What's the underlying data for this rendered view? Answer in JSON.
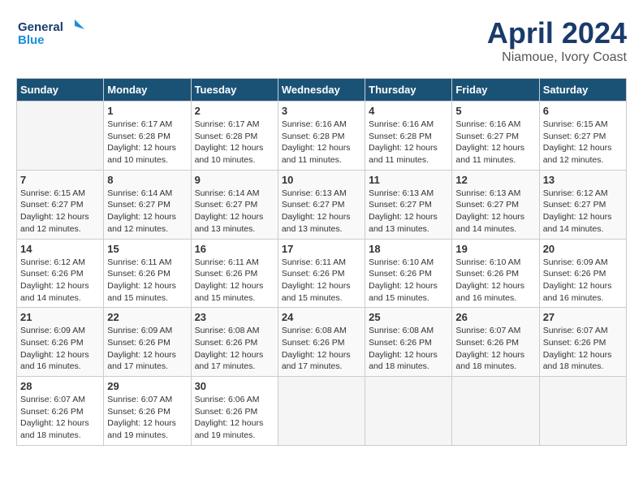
{
  "header": {
    "logo_line1": "General",
    "logo_line2": "Blue",
    "month": "April 2024",
    "location": "Niamoue, Ivory Coast"
  },
  "weekdays": [
    "Sunday",
    "Monday",
    "Tuesday",
    "Wednesday",
    "Thursday",
    "Friday",
    "Saturday"
  ],
  "weeks": [
    [
      {
        "day": "",
        "info": ""
      },
      {
        "day": "1",
        "info": "Sunrise: 6:17 AM\nSunset: 6:28 PM\nDaylight: 12 hours\nand 10 minutes."
      },
      {
        "day": "2",
        "info": "Sunrise: 6:17 AM\nSunset: 6:28 PM\nDaylight: 12 hours\nand 10 minutes."
      },
      {
        "day": "3",
        "info": "Sunrise: 6:16 AM\nSunset: 6:28 PM\nDaylight: 12 hours\nand 11 minutes."
      },
      {
        "day": "4",
        "info": "Sunrise: 6:16 AM\nSunset: 6:28 PM\nDaylight: 12 hours\nand 11 minutes."
      },
      {
        "day": "5",
        "info": "Sunrise: 6:16 AM\nSunset: 6:27 PM\nDaylight: 12 hours\nand 11 minutes."
      },
      {
        "day": "6",
        "info": "Sunrise: 6:15 AM\nSunset: 6:27 PM\nDaylight: 12 hours\nand 12 minutes."
      }
    ],
    [
      {
        "day": "7",
        "info": "Sunrise: 6:15 AM\nSunset: 6:27 PM\nDaylight: 12 hours\nand 12 minutes."
      },
      {
        "day": "8",
        "info": "Sunrise: 6:14 AM\nSunset: 6:27 PM\nDaylight: 12 hours\nand 12 minutes."
      },
      {
        "day": "9",
        "info": "Sunrise: 6:14 AM\nSunset: 6:27 PM\nDaylight: 12 hours\nand 13 minutes."
      },
      {
        "day": "10",
        "info": "Sunrise: 6:13 AM\nSunset: 6:27 PM\nDaylight: 12 hours\nand 13 minutes."
      },
      {
        "day": "11",
        "info": "Sunrise: 6:13 AM\nSunset: 6:27 PM\nDaylight: 12 hours\nand 13 minutes."
      },
      {
        "day": "12",
        "info": "Sunrise: 6:13 AM\nSunset: 6:27 PM\nDaylight: 12 hours\nand 14 minutes."
      },
      {
        "day": "13",
        "info": "Sunrise: 6:12 AM\nSunset: 6:27 PM\nDaylight: 12 hours\nand 14 minutes."
      }
    ],
    [
      {
        "day": "14",
        "info": "Sunrise: 6:12 AM\nSunset: 6:26 PM\nDaylight: 12 hours\nand 14 minutes."
      },
      {
        "day": "15",
        "info": "Sunrise: 6:11 AM\nSunset: 6:26 PM\nDaylight: 12 hours\nand 15 minutes."
      },
      {
        "day": "16",
        "info": "Sunrise: 6:11 AM\nSunset: 6:26 PM\nDaylight: 12 hours\nand 15 minutes."
      },
      {
        "day": "17",
        "info": "Sunrise: 6:11 AM\nSunset: 6:26 PM\nDaylight: 12 hours\nand 15 minutes."
      },
      {
        "day": "18",
        "info": "Sunrise: 6:10 AM\nSunset: 6:26 PM\nDaylight: 12 hours\nand 15 minutes."
      },
      {
        "day": "19",
        "info": "Sunrise: 6:10 AM\nSunset: 6:26 PM\nDaylight: 12 hours\nand 16 minutes."
      },
      {
        "day": "20",
        "info": "Sunrise: 6:09 AM\nSunset: 6:26 PM\nDaylight: 12 hours\nand 16 minutes."
      }
    ],
    [
      {
        "day": "21",
        "info": "Sunrise: 6:09 AM\nSunset: 6:26 PM\nDaylight: 12 hours\nand 16 minutes."
      },
      {
        "day": "22",
        "info": "Sunrise: 6:09 AM\nSunset: 6:26 PM\nDaylight: 12 hours\nand 17 minutes."
      },
      {
        "day": "23",
        "info": "Sunrise: 6:08 AM\nSunset: 6:26 PM\nDaylight: 12 hours\nand 17 minutes."
      },
      {
        "day": "24",
        "info": "Sunrise: 6:08 AM\nSunset: 6:26 PM\nDaylight: 12 hours\nand 17 minutes."
      },
      {
        "day": "25",
        "info": "Sunrise: 6:08 AM\nSunset: 6:26 PM\nDaylight: 12 hours\nand 18 minutes."
      },
      {
        "day": "26",
        "info": "Sunrise: 6:07 AM\nSunset: 6:26 PM\nDaylight: 12 hours\nand 18 minutes."
      },
      {
        "day": "27",
        "info": "Sunrise: 6:07 AM\nSunset: 6:26 PM\nDaylight: 12 hours\nand 18 minutes."
      }
    ],
    [
      {
        "day": "28",
        "info": "Sunrise: 6:07 AM\nSunset: 6:26 PM\nDaylight: 12 hours\nand 18 minutes."
      },
      {
        "day": "29",
        "info": "Sunrise: 6:07 AM\nSunset: 6:26 PM\nDaylight: 12 hours\nand 19 minutes."
      },
      {
        "day": "30",
        "info": "Sunrise: 6:06 AM\nSunset: 6:26 PM\nDaylight: 12 hours\nand 19 minutes."
      },
      {
        "day": "",
        "info": ""
      },
      {
        "day": "",
        "info": ""
      },
      {
        "day": "",
        "info": ""
      },
      {
        "day": "",
        "info": ""
      }
    ]
  ]
}
